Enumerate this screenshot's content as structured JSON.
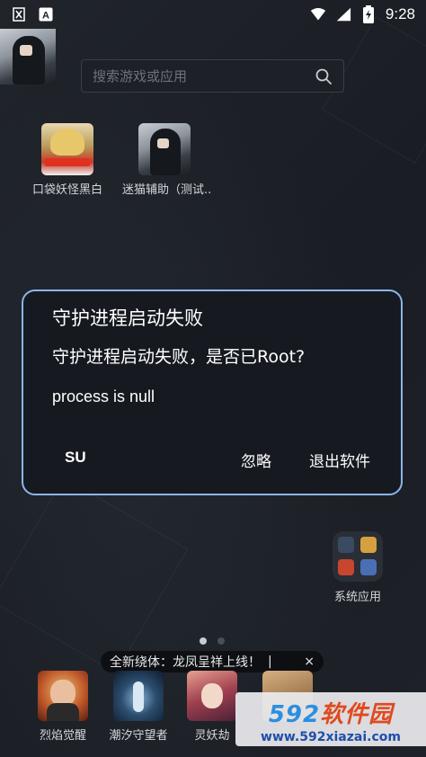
{
  "status_bar": {
    "time": "9:28",
    "left_icons": [
      "app-logo-icon",
      "font-a-icon"
    ],
    "right_icons": [
      "wifi-icon",
      "signal-icon",
      "battery-charging-icon"
    ]
  },
  "search": {
    "placeholder": "搜索游戏或应用"
  },
  "apps": [
    {
      "label": "口袋妖怪黑白",
      "icon": "pokemon-game-icon"
    },
    {
      "label": "迷猫辅助（测试..",
      "icon": "mimao-helper-icon"
    }
  ],
  "dialog": {
    "title": "守护进程启动失败",
    "message": "守护进程启动失败，是否已Root?",
    "extra": "process is null",
    "buttons": {
      "su": "SU",
      "ignore": "忽略",
      "exit": "退出软件"
    },
    "border_color": "#8ab6ea"
  },
  "folder": {
    "label": "系统应用"
  },
  "pager": {
    "count": 2,
    "active": 0
  },
  "banner": {
    "text": "全新绕体：龙凤呈祥上线！",
    "separator": "|",
    "close": "×"
  },
  "dock": [
    {
      "label": "烈焰觉醒",
      "icon": "lieyan-game-icon"
    },
    {
      "label": "潮汐守望者",
      "icon": "chaoxi-game-icon"
    },
    {
      "label": "灵妖劫",
      "icon": "lingyao-game-icon"
    }
  ],
  "watermark": {
    "num": "592",
    "cn": "软件园",
    "url": "www.592xiazai.com"
  }
}
